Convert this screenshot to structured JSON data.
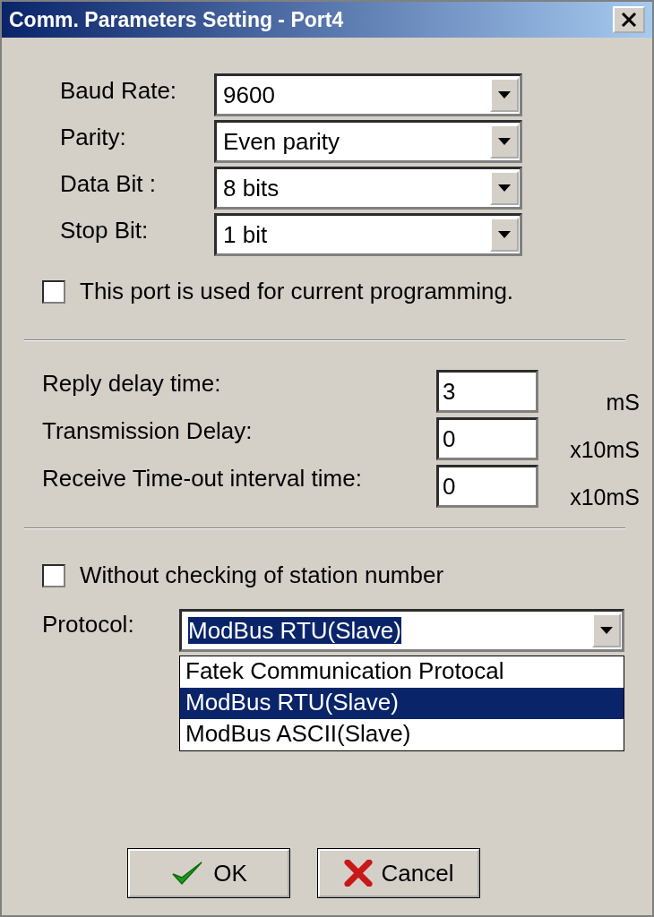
{
  "window": {
    "title": "Comm. Parameters Setting - Port4"
  },
  "serial_settings": [
    {
      "label": "Baud Rate:",
      "value": "9600"
    },
    {
      "label": "Parity:",
      "value": "Even parity"
    },
    {
      "label": "Data Bit :",
      "value": "8 bits"
    },
    {
      "label": "Stop Bit:",
      "value": "1 bit"
    }
  ],
  "programming_port": {
    "label": "This port is used for current programming.",
    "checked": false
  },
  "delays": [
    {
      "label": "Reply delay time:",
      "value": "3",
      "unit": "mS"
    },
    {
      "label": "Transmission Delay:",
      "value": "0",
      "unit": "x10mS"
    },
    {
      "label": "Receive Time-out interval time:",
      "value": "0",
      "unit": "x10mS"
    }
  ],
  "station_check": {
    "label": "Without checking of station number",
    "checked": false
  },
  "protocol": {
    "label": "Protocol:",
    "value": "ModBus RTU(Slave)",
    "expanded": true,
    "options": [
      {
        "label": "Fatek Communication Protocal",
        "selected": false
      },
      {
        "label": "ModBus RTU(Slave)",
        "selected": true
      },
      {
        "label": "ModBus ASCII(Slave)",
        "selected": false
      }
    ]
  },
  "buttons": [
    {
      "label": "OK",
      "kind": "ok"
    },
    {
      "label": "Cancel",
      "kind": "cancel"
    }
  ]
}
